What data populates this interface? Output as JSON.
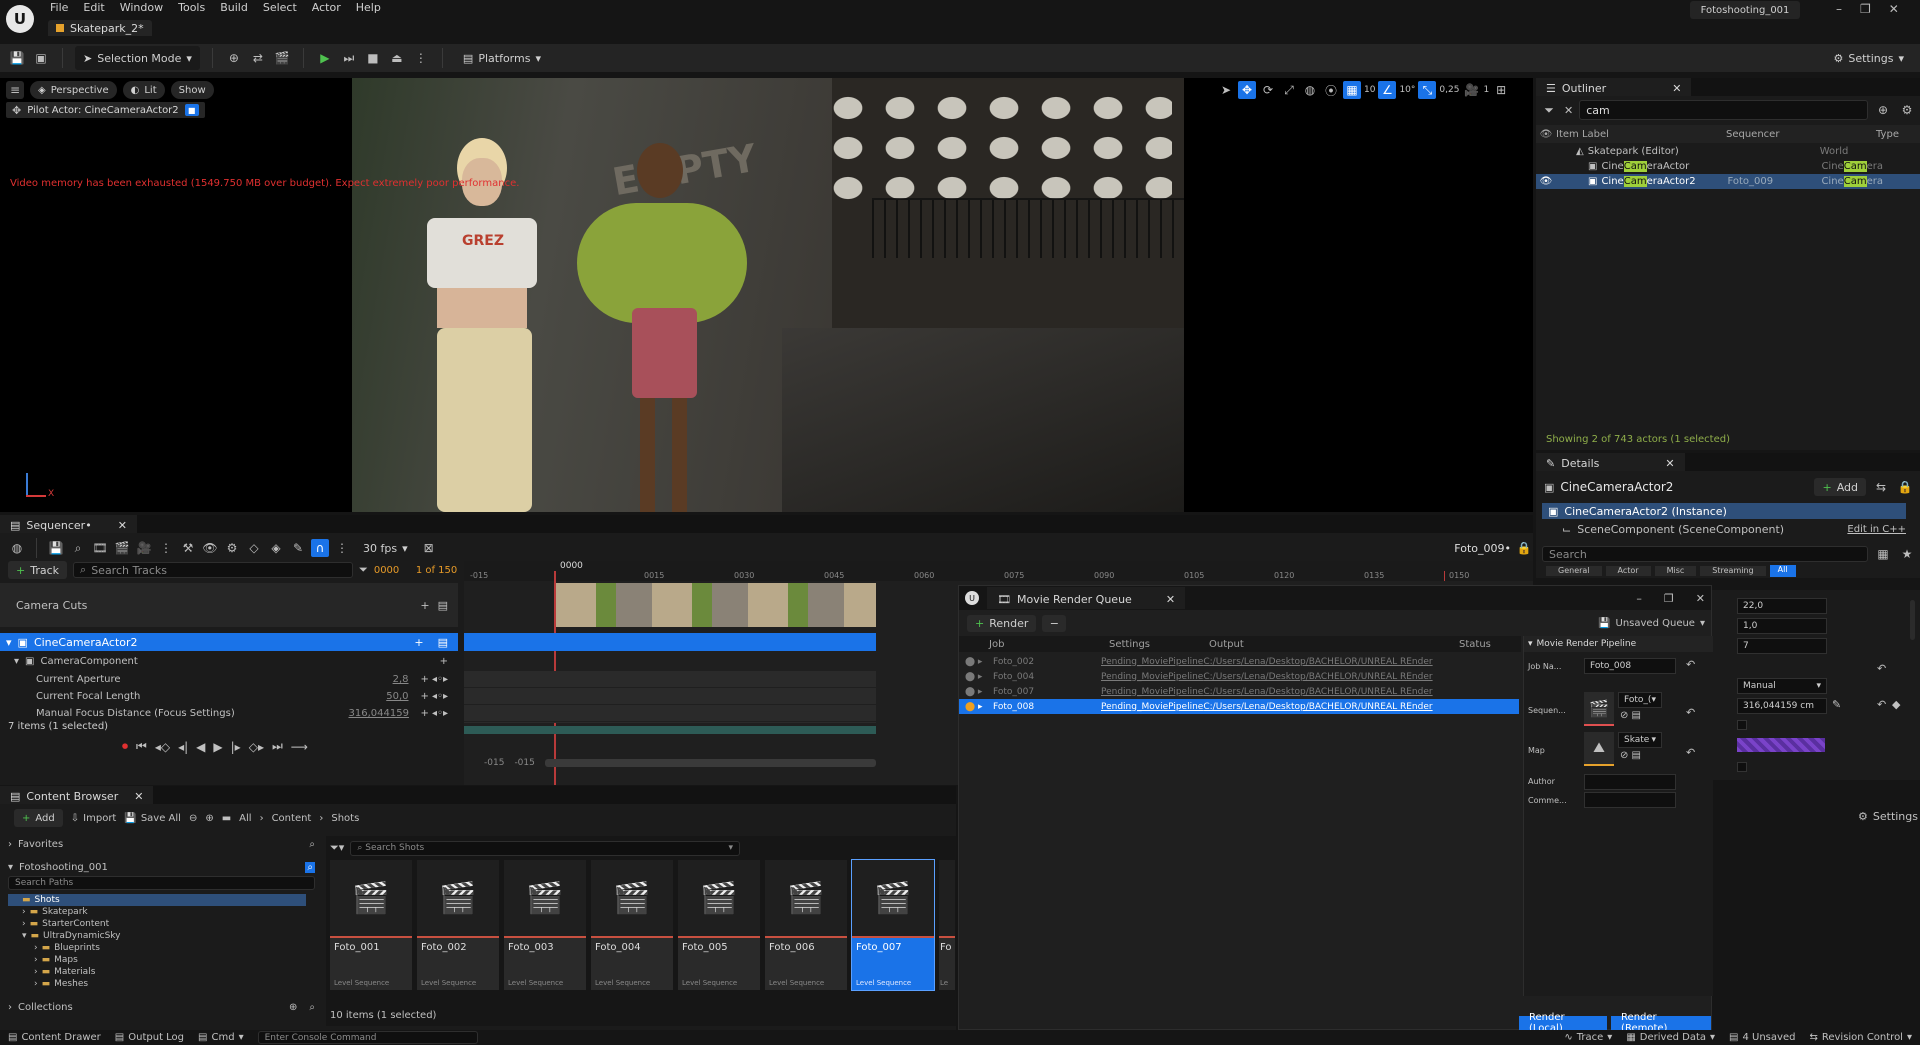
{
  "menubar": {
    "items": [
      "File",
      "Edit",
      "Window",
      "Tools",
      "Build",
      "Select",
      "Actor",
      "Help"
    ],
    "project_badge": "Fotoshooting_001"
  },
  "level_tab": {
    "label": "Skatepark_2*"
  },
  "toolbar": {
    "selection_mode": "Selection Mode",
    "platforms": "Platforms",
    "settings": "Settings"
  },
  "viewport": {
    "perspective": "Perspective",
    "lit": "Lit",
    "show": "Show",
    "pilot": "Pilot Actor: CineCameraActor2",
    "warning": "Video memory has been exhausted (1549.750 MB over budget). Expect extremely poor performance.",
    "grid_val": "10",
    "angle_val": "10°",
    "scale_val": "0,25",
    "cam_val": "1",
    "graffiti_a": "EMPTY",
    "graffiti_b": "GREZ",
    "axis_label": "X"
  },
  "outliner": {
    "tab": "Outliner",
    "search": "cam",
    "col_label": "Item Label",
    "col_sequencer": "Sequencer",
    "col_type": "Type",
    "world_row": {
      "label": "Skatepark (Editor)",
      "type": "World"
    },
    "rows": [
      {
        "pre": "Cine",
        "hl": "Cam",
        "post": "eraActor",
        "sequencer": "",
        "type_pre": "Cine",
        "type_hl": "Cam",
        "type_post": "era"
      },
      {
        "pre": "Cine",
        "hl": "Cam",
        "post": "eraActor2",
        "sequencer": "Foto_009",
        "type_pre": "Cine",
        "type_hl": "Cam",
        "type_post": "era"
      }
    ],
    "status": "Showing 2 of 743 actors (1 selected)"
  },
  "details": {
    "tab": "Details",
    "title": "CineCameraActor2",
    "add": "Add",
    "instance": "CineCameraActor2 (Instance)",
    "scene": "SceneComponent (SceneComponent)",
    "edit_cpp": "Edit in C++",
    "search": "Search",
    "filters": [
      "General",
      "Actor",
      "Misc",
      "Streaming",
      "All"
    ],
    "values": [
      "22,0",
      "1,0",
      "7"
    ],
    "manual": "Manual",
    "focus": "316,044159 cm",
    "settings": "Settings"
  },
  "sequencer": {
    "tab": "Sequencer•",
    "fps": "30 fps",
    "seq_name": "Foto_009•",
    "track_btn": "Track",
    "search": "Search Tracks",
    "frame_current": "0000",
    "frame_info": "1 of 150",
    "ruler_start": "0000",
    "ruler": [
      "-015",
      "0015",
      "0030",
      "0045",
      "0060",
      "0075",
      "0090",
      "0105",
      "0120",
      "0135",
      "0150"
    ],
    "tracks": {
      "camera_cuts": "Camera Cuts",
      "actor": "CineCameraActor2",
      "component": "CameraComponent",
      "props": [
        {
          "label": "Current Aperture",
          "value": "2,8"
        },
        {
          "label": "Current Focal Length",
          "value": "50,0"
        },
        {
          "label": "Manual Focus Distance (Focus Settings)",
          "value": "316,044159"
        }
      ]
    },
    "items_count": "7 items (1 selected)",
    "bottom_a": "-015",
    "bottom_b": "-015"
  },
  "mrq": {
    "tab": "Movie Render Queue",
    "render_btn": "Render",
    "unsaved": "Unsaved Queue",
    "cols": {
      "job": "Job",
      "settings": "Settings",
      "output": "Output",
      "status": "Status"
    },
    "jobs": [
      {
        "name": "Foto_002",
        "pending": "Pending_MoviePipeline",
        "output": "C:/Users/Lena/Desktop/BACHELOR/UNREAL REnder"
      },
      {
        "name": "Foto_004",
        "pending": "Pending_MoviePipeline",
        "output": "C:/Users/Lena/Desktop/BACHELOR/UNREAL REnder"
      },
      {
        "name": "Foto_007",
        "pending": "Pending_MoviePipeline",
        "output": "C:/Users/Lena/Desktop/BACHELOR/UNREAL REnder"
      },
      {
        "name": "Foto_008",
        "pending": "Pending_MoviePipeline",
        "output": "C:/Users/Lena/Desktop/BACHELOR/UNREAL REnder"
      }
    ],
    "pipeline_title": "Movie Render Pipeline",
    "job_name_label": "Job Na...",
    "job_name": "Foto_008",
    "sequence_label": "Sequen...",
    "sequence_val": "Foto_(",
    "map_label": "Map",
    "map_val": "Skate",
    "author_label": "Author",
    "comment_label": "Comme...",
    "render_local": "Render (Local)",
    "render_remote": "Render (Remote)"
  },
  "content_browser": {
    "tab": "Content Browser",
    "add": "Add",
    "import": "Import",
    "save_all": "Save All",
    "breadcrumb": [
      "All",
      "Content",
      "Shots"
    ],
    "favorites": "Favorites",
    "project": "Fotoshooting_001",
    "search_paths": "Search Paths",
    "tree": [
      {
        "label": "Shots",
        "indent": 1,
        "selected": true
      },
      {
        "label": "Skatepark",
        "indent": 1
      },
      {
        "label": "StarterContent",
        "indent": 1
      },
      {
        "label": "UltraDynamicSky",
        "indent": 1
      },
      {
        "label": "Blueprints",
        "indent": 2
      },
      {
        "label": "Maps",
        "indent": 2
      },
      {
        "label": "Materials",
        "indent": 2
      },
      {
        "label": "Meshes",
        "indent": 2
      }
    ],
    "collections": "Collections",
    "search_shots": "Search Shots",
    "assets": [
      {
        "name": "Foto_001",
        "type": "Level Sequence"
      },
      {
        "name": "Foto_002",
        "type": "Level Sequence"
      },
      {
        "name": "Foto_003",
        "type": "Level Sequence"
      },
      {
        "name": "Foto_004",
        "type": "Level Sequence"
      },
      {
        "name": "Foto_005",
        "type": "Level Sequence"
      },
      {
        "name": "Foto_006",
        "type": "Level Sequence"
      },
      {
        "name": "Foto_007",
        "type": "Level Sequence"
      },
      {
        "name": "Fo",
        "type": "Le"
      }
    ],
    "count": "10 items (1 selected)"
  },
  "statusbar": {
    "content_drawer": "Content Drawer",
    "output_log": "Output Log",
    "cmd": "Cmd",
    "console": "Enter Console Command",
    "trace": "Trace",
    "derived": "Derived Data",
    "unsaved": "4 Unsaved",
    "revision": "Revision Control"
  }
}
